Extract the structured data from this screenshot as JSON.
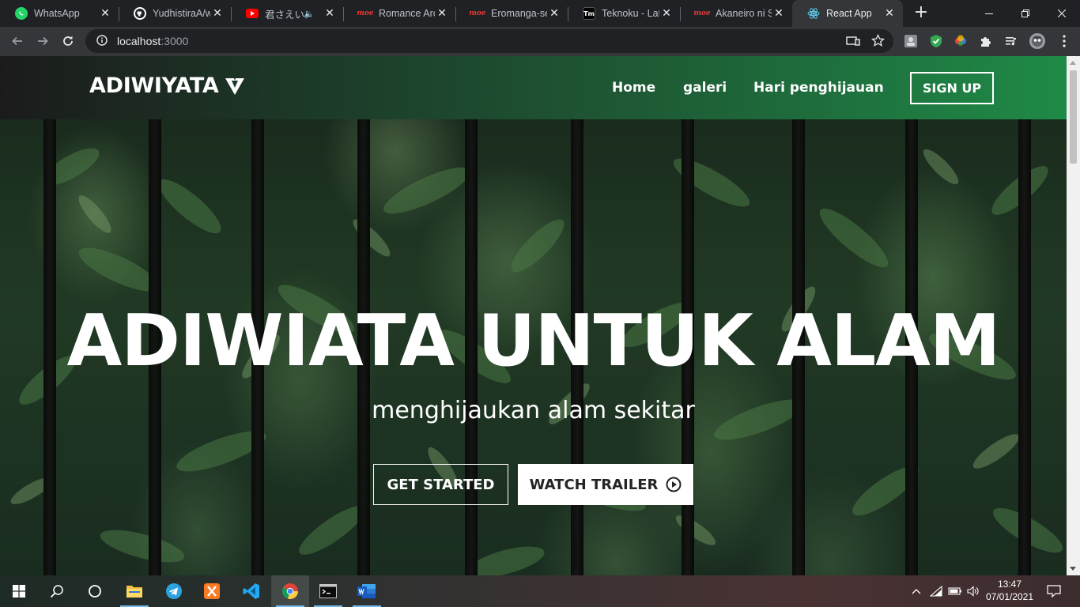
{
  "browser": {
    "tabs": [
      {
        "title": "WhatsApp",
        "icon": "whatsapp-icon"
      },
      {
        "title": "YudhistiraA/we",
        "icon": "github-icon"
      },
      {
        "title": "君さえいなけ",
        "icon": "youtube-icon"
      },
      {
        "title": "Romance Archi",
        "icon": "moe-icon"
      },
      {
        "title": "Eromanga-sen",
        "icon": "moe-icon"
      },
      {
        "title": "Teknoku - Late",
        "icon": "tm-icon",
        "badge": "Tm"
      },
      {
        "title": "Akaneiro ni So",
        "icon": "moe-icon"
      },
      {
        "title": "React App",
        "icon": "react-icon"
      }
    ],
    "moe_badge": "moe",
    "url_host": "localhost",
    "url_port": ":3000"
  },
  "site": {
    "brand": "ADIWIYATA",
    "nav": {
      "home": "Home",
      "galeri": "galeri",
      "hari": "Hari penghijauan",
      "signup": "SIGN UP"
    },
    "hero": {
      "title": "ADIWIATA UNTUK ALAM",
      "subtitle": "menghijaukan alam sekitar",
      "get_started": "GET STARTED",
      "watch_trailer": "WATCH TRAILER"
    }
  },
  "taskbar": {
    "time": "13:47",
    "date": "07/01/2021"
  },
  "colors": {
    "nav_gradient_start": "#1b1b1b",
    "nav_gradient_end": "#1f8a47",
    "browser_dark": "#202124",
    "browser_toolbar": "#35363a"
  }
}
